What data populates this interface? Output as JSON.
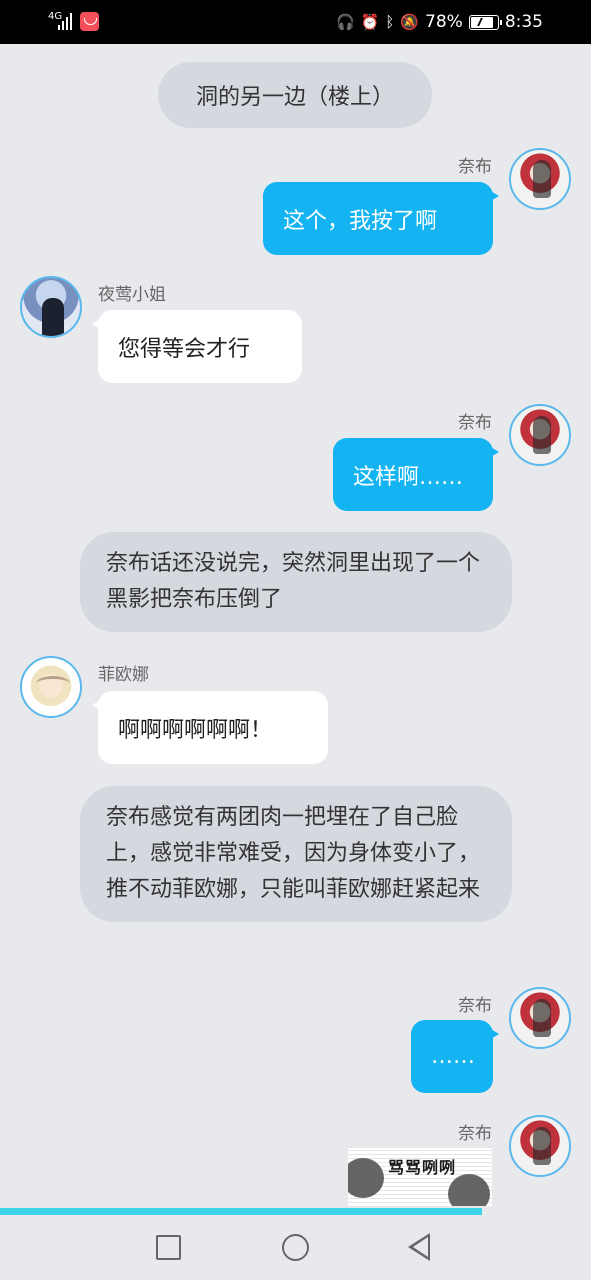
{
  "status_bar": {
    "network": "4G",
    "battery_percent": "78%",
    "time": "8:35",
    "icons": [
      "signal-icon",
      "app-notification-icon",
      "headphones-icon",
      "alarm-icon",
      "bluetooth-icon",
      "mute-icon",
      "battery-icon"
    ]
  },
  "chat": {
    "system_title": "洞的另一边（楼上）",
    "messages": [
      {
        "sender": "奈布",
        "text": "这个，我按了啊",
        "side": "right"
      },
      {
        "sender": "夜莺小姐",
        "text": "您得等会才行",
        "side": "left"
      },
      {
        "sender": "奈布",
        "text": "这样啊……",
        "side": "right"
      },
      {
        "narration": "奈布话还没说完，突然洞里出现了一个黑影把奈布压倒了"
      },
      {
        "sender": "菲欧娜",
        "text": "啊啊啊啊啊啊！",
        "side": "left"
      },
      {
        "narration": "奈布感觉有两团肉一把埋在了自己脸上，感觉非常难受，因为身体变小了，推不动菲欧娜，只能叫菲欧娜赶紧起来"
      },
      {
        "sender": "奈布",
        "text": "……",
        "side": "right"
      },
      {
        "sender": "奈布",
        "sticker_text": "骂骂咧咧",
        "side": "right"
      }
    ]
  },
  "progress": {
    "fraction": 0.815
  },
  "nav": {
    "icons": [
      "recent-apps-square-icon",
      "home-circle-icon",
      "back-triangle-icon"
    ]
  }
}
